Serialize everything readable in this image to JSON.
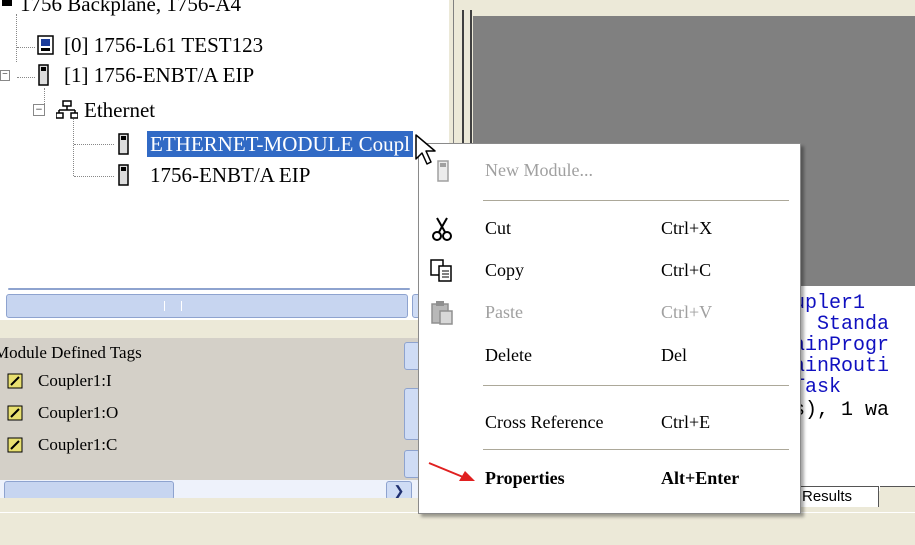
{
  "tree": {
    "backplane": "1756 Backplane, 1756-A4",
    "items": [
      {
        "label": "[0] 1756-L61 TEST123"
      },
      {
        "label": "[1] 1756-ENBT/A EIP"
      },
      {
        "label": "Ethernet"
      },
      {
        "label": "ETHERNET-MODULE Coupl"
      },
      {
        "label": "1756-ENBT/A EIP"
      }
    ]
  },
  "tags": {
    "header": "Module Defined Tags",
    "items": [
      "Coupler1:I",
      "Coupler1:O",
      "Coupler1:C"
    ]
  },
  "code_lines": [
    "upler1",
    ": Standa",
    "ainProgr",
    "ainRouti",
    "Task",
    "s), 1 wa"
  ],
  "results_tab": "Results",
  "context_menu": {
    "items": [
      {
        "label": "New Module...",
        "shortcut": "",
        "enabled": false
      },
      {
        "label": "Cut",
        "shortcut": "Ctrl+X",
        "enabled": true,
        "icon": "scissors-icon"
      },
      {
        "label": "Copy",
        "shortcut": "Ctrl+C",
        "enabled": true,
        "icon": "copy-icon"
      },
      {
        "label": "Paste",
        "shortcut": "Ctrl+V",
        "enabled": false,
        "icon": "paste-icon"
      },
      {
        "label": "Delete",
        "shortcut": "Del",
        "enabled": true
      },
      {
        "label": "Cross Reference",
        "shortcut": "Ctrl+E",
        "enabled": true
      },
      {
        "label": "Properties",
        "shortcut": "Alt+Enter",
        "enabled": true
      }
    ]
  },
  "colors": {
    "selection": "#316ac5",
    "gray_pane": "#808080",
    "code_text": "#1010c0",
    "annotation_arrow": "#e02020"
  }
}
